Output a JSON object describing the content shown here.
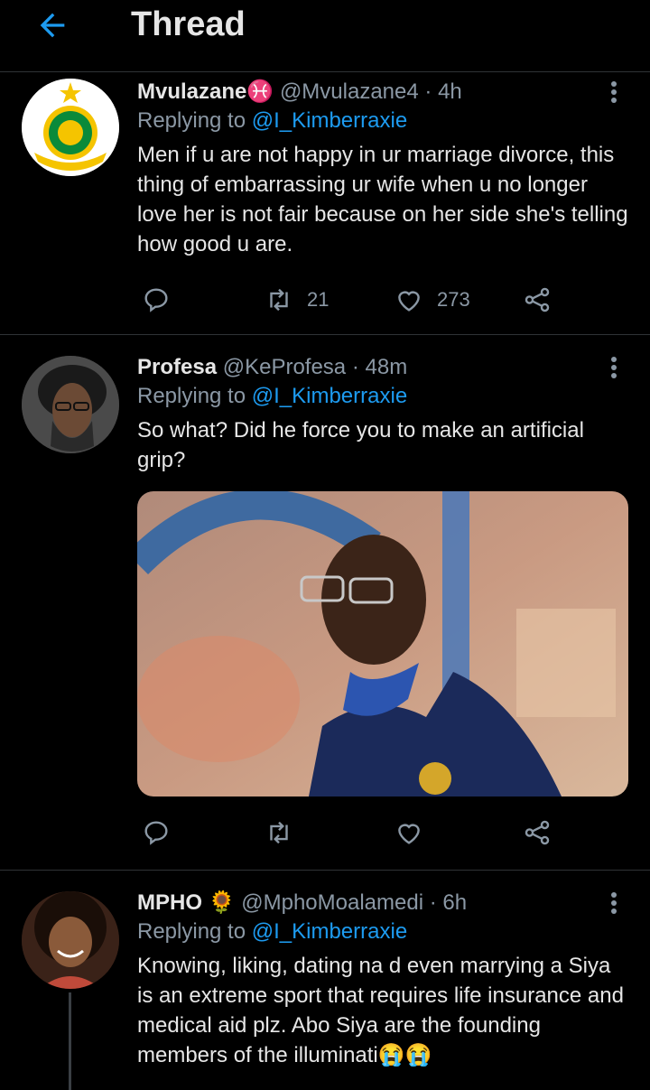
{
  "header": {
    "title": "Thread"
  },
  "tweets": [
    {
      "name": "Mvulazane",
      "name_emoji": "♓",
      "handle": "@Mvulazane4",
      "time": "4h",
      "replying_prefix": "Replying to",
      "replying_to": "@I_Kimberraxie",
      "text": "Men if u are not happy in ur marriage divorce, this thing of embarrassing ur wife when u no longer love her is not fair because on her side she's telling how good u are.",
      "retweets": "21",
      "likes": "273",
      "avatar_text": "SUNDOWNS"
    },
    {
      "name": "Profesa",
      "handle": "@KeProfesa",
      "time": "48m",
      "replying_prefix": "Replying to",
      "replying_to": "@I_Kimberraxie",
      "text": "So what? Did he force you to make an artificial grip?",
      "retweets": "",
      "likes": ""
    },
    {
      "name": "MPHO",
      "name_emoji": "🌻",
      "handle": "@MphoMoalamedi",
      "time": "6h",
      "replying_prefix": "Replying to",
      "replying_to": "@I_Kimberraxie",
      "text": "Knowing, liking, dating na d even marrying a Siya is an extreme sport that requires life insurance and medical aid plz. Abo Siya are the founding members of the illuminati😭😭"
    }
  ],
  "icons": {
    "back": "arrow-left-icon",
    "reply": "reply-icon",
    "retweet": "retweet-icon",
    "like": "heart-icon",
    "share": "share-icon",
    "more": "more-vertical-icon"
  },
  "colors": {
    "accent": "#1d9bf0",
    "background": "#000000",
    "muted": "#8b98a5"
  }
}
